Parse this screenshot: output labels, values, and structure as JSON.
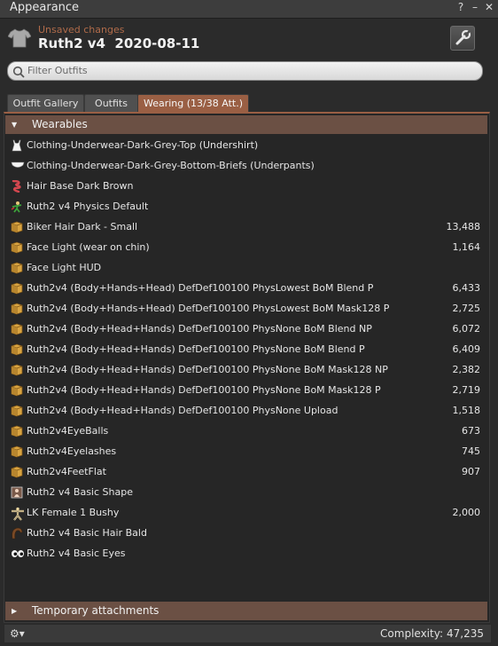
{
  "window": {
    "title": "Appearance",
    "help": "?",
    "minimize": "–",
    "close": "✕"
  },
  "header": {
    "unsaved": "Unsaved changes",
    "outfit_name": "Ruth2 v4  2020-08-11",
    "icon": "shirt-icon",
    "wrench_icon": "wrench-icon"
  },
  "search": {
    "placeholder": "Filter Outfits"
  },
  "tabs": [
    {
      "label": "Outfit Gallery",
      "active": false
    },
    {
      "label": "Outfits",
      "active": false
    },
    {
      "label": "Wearing (13/38 Att.)",
      "active": true
    }
  ],
  "wearables": {
    "label": "Wearables",
    "items": [
      {
        "icon": "undershirt-icon",
        "name": "Clothing-Underwear-Dark-Grey-Top (Undershirt)",
        "value": ""
      },
      {
        "icon": "underpants-icon",
        "name": "Clothing-Underwear-Dark-Grey-Bottom-Briefs (Underpants)",
        "value": ""
      },
      {
        "icon": "hair-icon",
        "name": "Hair Base Dark Brown",
        "value": ""
      },
      {
        "icon": "physics-icon",
        "name": "Ruth2 v4 Physics Default",
        "value": ""
      },
      {
        "icon": "object-box-icon",
        "name": "Biker Hair Dark - Small",
        "value": "13,488"
      },
      {
        "icon": "object-box-icon",
        "name": "Face Light (wear on chin)",
        "value": "1,164"
      },
      {
        "icon": "object-box-icon",
        "name": "Face Light HUD",
        "value": ""
      },
      {
        "icon": "object-box-icon",
        "name": "Ruth2v4 (Body+Hands+Head) DefDef100100 PhysLowest BoM Blend P",
        "value": "6,433"
      },
      {
        "icon": "object-box-icon",
        "name": "Ruth2v4 (Body+Hands+Head) DefDef100100 PhysLowest BoM Mask128 P",
        "value": "2,725"
      },
      {
        "icon": "object-box-icon",
        "name": "Ruth2v4 (Body+Head+Hands) DefDef100100 PhysNone BoM Blend NP",
        "value": "6,072"
      },
      {
        "icon": "object-box-icon",
        "name": "Ruth2v4 (Body+Head+Hands) DefDef100100 PhysNone BoM Blend P",
        "value": "6,409"
      },
      {
        "icon": "object-box-icon",
        "name": "Ruth2v4 (Body+Head+Hands) DefDef100100 PhysNone BoM Mask128 NP",
        "value": "2,382"
      },
      {
        "icon": "object-box-icon",
        "name": "Ruth2v4 (Body+Head+Hands) DefDef100100 PhysNone BoM Mask128 P",
        "value": "2,719"
      },
      {
        "icon": "object-box-icon",
        "name": "Ruth2v4 (Body+Head+Hands) DefDef100100 PhysNone Upload",
        "value": "1,518"
      },
      {
        "icon": "object-box-icon",
        "name": "Ruth2v4EyeBalls",
        "value": "673"
      },
      {
        "icon": "object-box-icon",
        "name": "Ruth2v4Eyelashes",
        "value": "745"
      },
      {
        "icon": "object-box-icon",
        "name": "Ruth2v4FeetFlat",
        "value": "907"
      },
      {
        "icon": "shape-icon",
        "name": "Ruth2 v4 Basic Shape",
        "value": ""
      },
      {
        "icon": "skin-figure-icon",
        "name": "LK Female 1 Bushy",
        "value": "2,000"
      },
      {
        "icon": "hair-bald-icon",
        "name": "Ruth2 v4 Basic Hair Bald",
        "value": ""
      },
      {
        "icon": "eyes-icon",
        "name": "Ruth2 v4 Basic Eyes",
        "value": ""
      }
    ]
  },
  "temporary": {
    "label": "Temporary attachments"
  },
  "footer": {
    "complexity_label": "Complexity:",
    "complexity_value": "47,235",
    "gear": "⚙▾"
  },
  "colors": {
    "accent": "#9a5f44",
    "section_header": "#6b5044",
    "unsaved_text": "#b06b4a",
    "box_icon": "#d9a441"
  }
}
